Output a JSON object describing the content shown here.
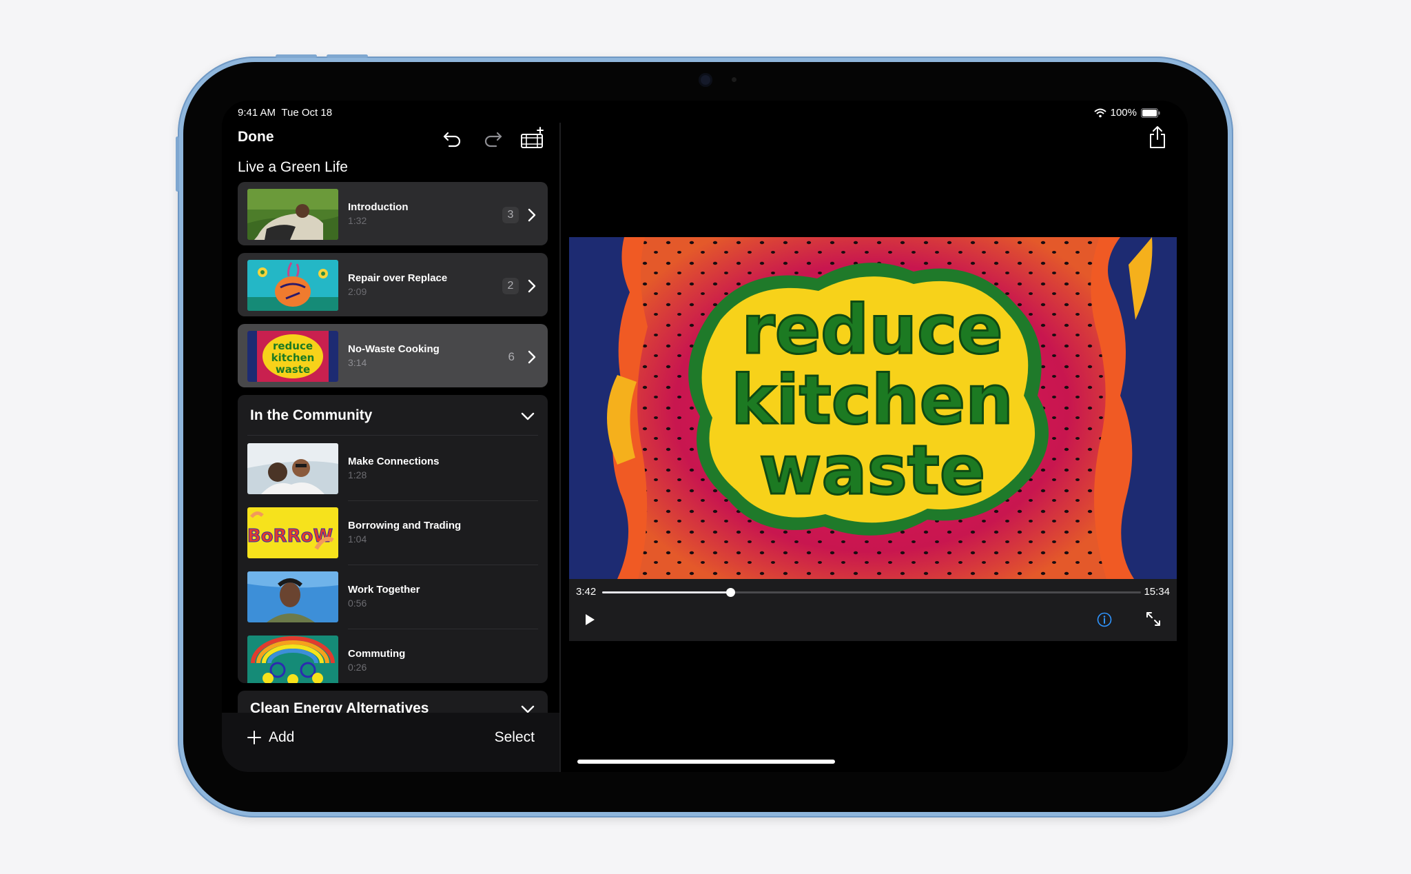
{
  "status_bar": {
    "time": "9:41 AM",
    "date": "Tue Oct 18",
    "battery": "100%"
  },
  "nav": {
    "done_label": "Done",
    "project_title": "Live a Green Life"
  },
  "chapters": [
    {
      "title": "Introduction",
      "duration": "1:32",
      "count": "3"
    },
    {
      "title": "Repair over Replace",
      "duration": "2:09",
      "count": "2"
    },
    {
      "title": "No-Waste Cooking",
      "duration": "3:14",
      "count": "6"
    }
  ],
  "community": {
    "title": "In the Community",
    "items": [
      {
        "title": "Make Connections",
        "duration": "1:28"
      },
      {
        "title": "Borrowing and Trading",
        "duration": "1:04"
      },
      {
        "title": "Work Together",
        "duration": "0:56"
      },
      {
        "title": "Commuting",
        "duration": "0:26"
      }
    ]
  },
  "energy": {
    "title": "Clean Energy Alternatives"
  },
  "toolbar": {
    "add_label": "Add",
    "select_label": "Select"
  },
  "player": {
    "current_time": "3:42",
    "total_time": "15:34",
    "progress": 0.2375,
    "title_art_lines": [
      "reduce",
      "kitchen",
      "waste"
    ]
  },
  "thumb_text": {
    "borrow": "BoRRoW"
  },
  "colors": {
    "accent": "#2f95ff",
    "background": "#000000",
    "device": "#8fb6dc",
    "card": "#1c1c1e"
  }
}
